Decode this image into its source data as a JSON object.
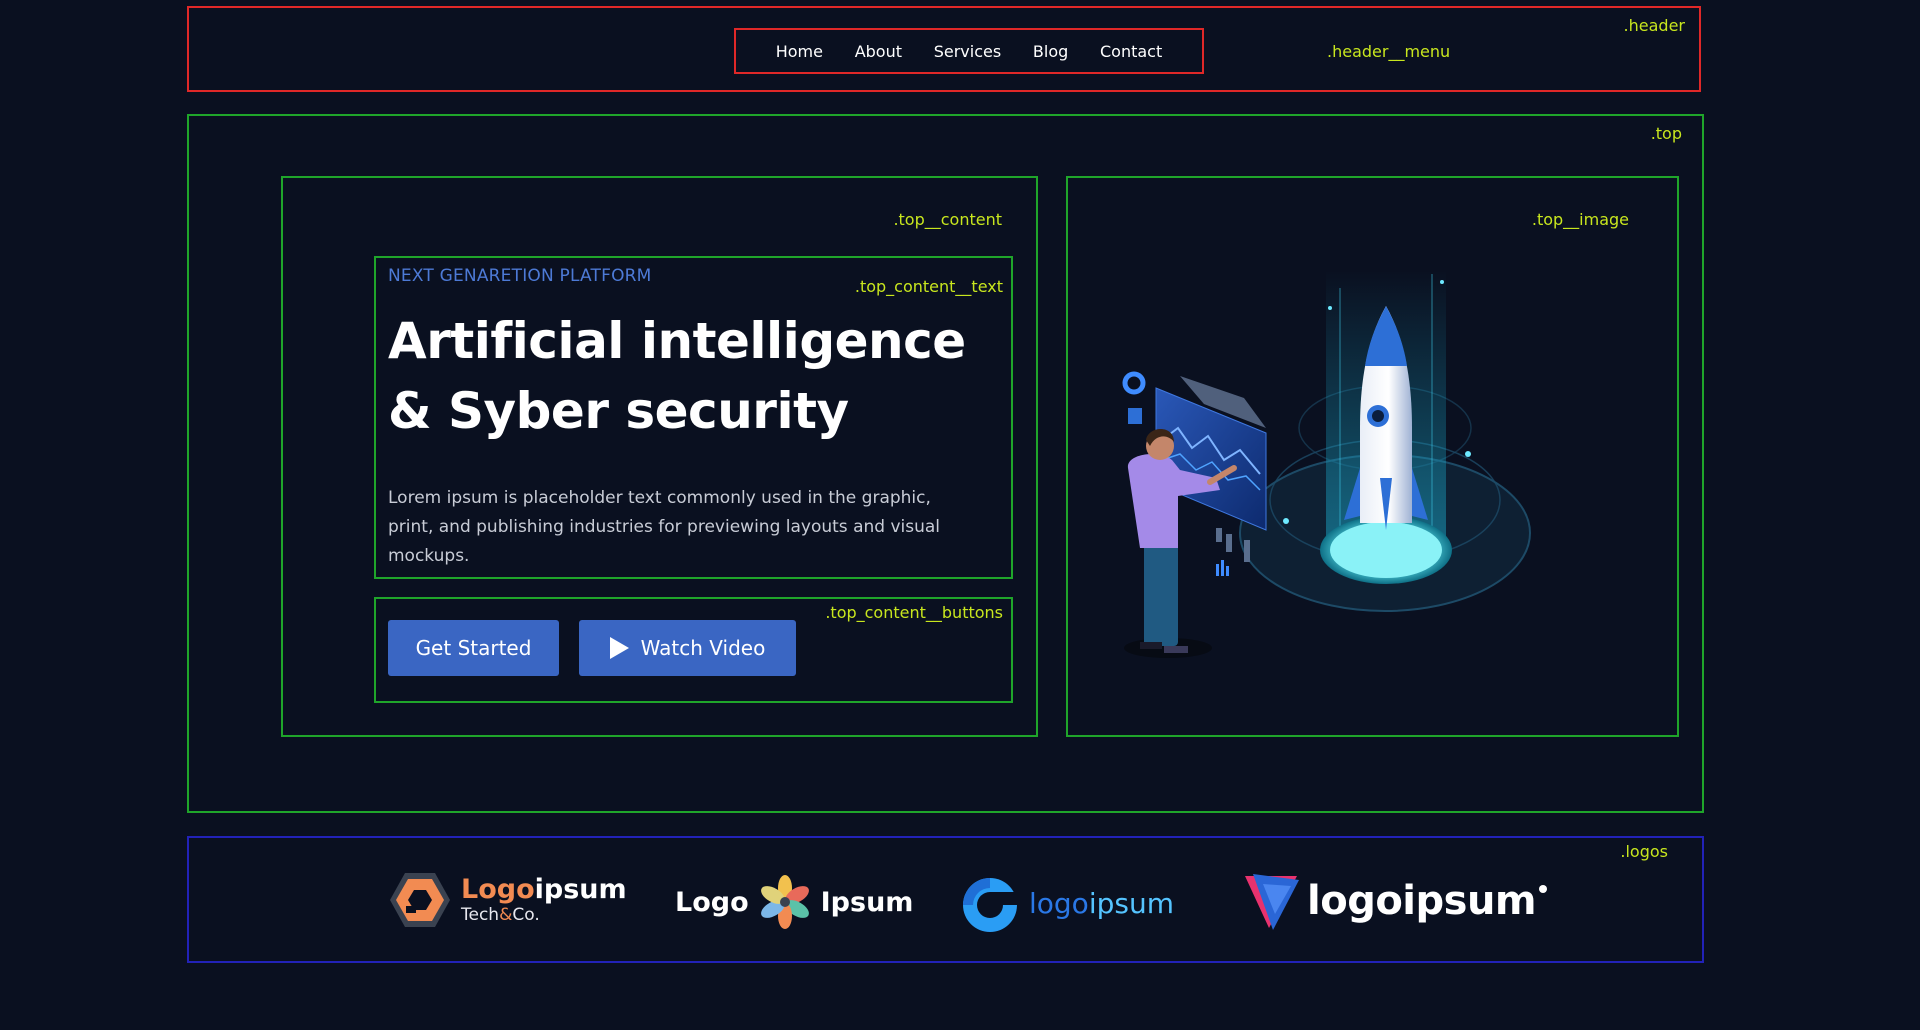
{
  "labels": {
    "header": ".header",
    "header_menu": ".header__menu",
    "top": ".top",
    "top_content": ".top__content",
    "top_image": ".top__image",
    "top_content_text": ".top_content__text",
    "top_content_buttons": ".top_content__buttons",
    "logos": ".logos"
  },
  "nav": {
    "items": [
      {
        "label": "Home"
      },
      {
        "label": "About"
      },
      {
        "label": "Services"
      },
      {
        "label": "Blog"
      },
      {
        "label": "Contact"
      }
    ]
  },
  "hero": {
    "eyebrow": "NEXT GENARETION PLATFORM",
    "headline_line1": "Artificial intelligence",
    "headline_line2": "& Syber security",
    "description": "Lorem ipsum is placeholder text commonly used in the graphic, print, and publishing industries for previewing layouts and visual mockups.",
    "get_started": "Get Started",
    "watch_video": "Watch Video"
  },
  "logos": [
    {
      "brand_a": "Logo",
      "brand_b": "ipsum",
      "sub_a": "Tech",
      "sub_amp": "&",
      "sub_b": "Co."
    },
    {
      "left": "Logo",
      "right": "Ipsum"
    },
    {
      "a": "logo",
      "b": "ipsum"
    },
    {
      "text": "logoipsum"
    }
  ],
  "colors": {
    "background": "#0a1020",
    "accent": "#3a66c3",
    "eyebrow": "#4d7ad6",
    "label": "#c8e61e"
  }
}
